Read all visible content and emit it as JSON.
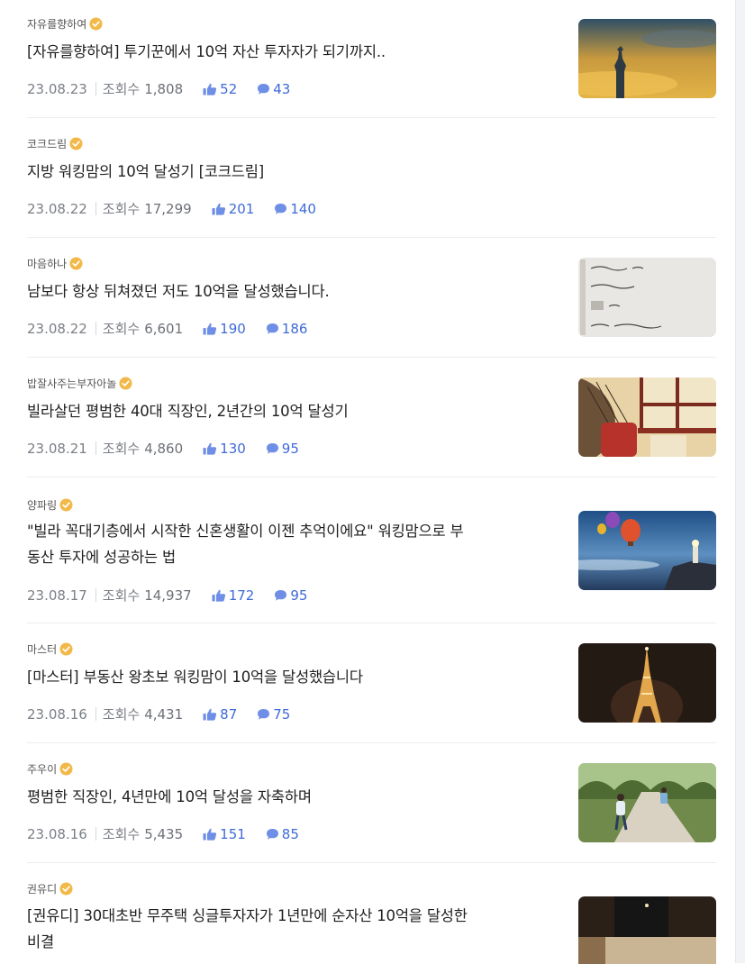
{
  "posts": [
    {
      "author": "자유를향하여",
      "title_lines": [
        "[자유를향하여] 투기꾼에서 10억 자산 투자자가 되기까지.."
      ],
      "date": "23.08.23",
      "views_label": "조회수",
      "views": "1,808",
      "likes": "52",
      "comments": "43",
      "thumbnail": "statue-of-liberty-sunset"
    },
    {
      "author": "코크드림",
      "title_lines": [
        "지방 워킹맘의 10억 달성기 [코크드림]"
      ],
      "date": "23.08.22",
      "views_label": "조회수",
      "views": "17,299",
      "likes": "201",
      "comments": "140",
      "thumbnail": ""
    },
    {
      "author": "마음하나",
      "title_lines": [
        "남보다 항상 뒤쳐졌던 저도 10억을 달성했습니다."
      ],
      "date": "23.08.22",
      "views_label": "조회수",
      "views": "6,601",
      "likes": "190",
      "comments": "186",
      "thumbnail": "handwritten-note"
    },
    {
      "author": "밥잘사주는부자아놀",
      "title_lines": [
        "빌라살던 평범한 40대 직장인, 2년간의 10억 달성기"
      ],
      "date": "23.08.21",
      "views_label": "조회수",
      "views": "4,860",
      "likes": "130",
      "comments": "95",
      "thumbnail": "illustration-window"
    },
    {
      "author": "양파링",
      "title_lines": [
        "\"빌라 꼭대기층에서 시작한 신혼생활이 이젠 추억이에요\" 워킹맘으로 부",
        "동산 투자에 성공하는 법"
      ],
      "date": "23.08.17",
      "views_label": "조회수",
      "views": "14,937",
      "likes": "172",
      "comments": "95",
      "thumbnail": "hot-air-balloons-lighthouse"
    },
    {
      "author": "마스터",
      "title_lines": [
        "[마스터] 부동산 왕초보 워킹맘이 10억을 달성했습니다"
      ],
      "date": "23.08.16",
      "views_label": "조회수",
      "views": "4,431",
      "likes": "87",
      "comments": "75",
      "thumbnail": "eiffel-tower-night"
    },
    {
      "author": "주우이",
      "title_lines": [
        "평범한 직장인, 4년만에 10억 달성을 자축하며"
      ],
      "date": "23.08.16",
      "views_label": "조회수",
      "views": "5,435",
      "likes": "151",
      "comments": "85",
      "thumbnail": "children-running-path"
    },
    {
      "author": "권유디",
      "title_lines": [
        "[권유디] 30대초반 무주택 싱글투자자가 1년만에 순자산 10억을 달성한",
        "비결"
      ],
      "date": "",
      "views_label": "",
      "views": "",
      "likes": "",
      "comments": "",
      "thumbnail": "dark-window-room"
    }
  ],
  "colors": {
    "accent": "#3f6ad8",
    "verified_badge": "#f2b94a",
    "meta_text": "#7b7f86",
    "divider": "#ececec"
  },
  "icons": {
    "verified": "verified-badge-icon",
    "likes": "thumbs-up-icon",
    "comments": "comment-bubble-icon"
  }
}
